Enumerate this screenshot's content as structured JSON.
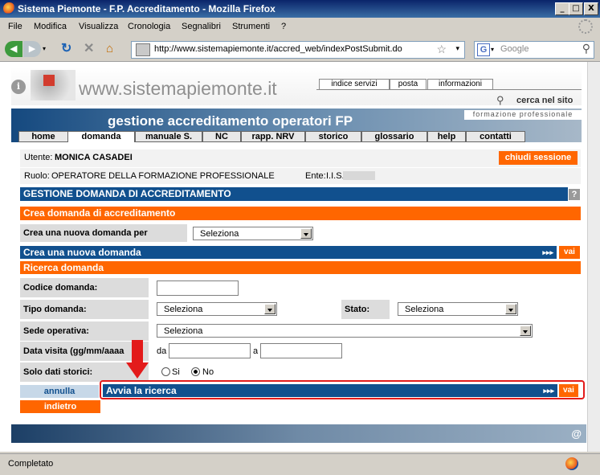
{
  "window": {
    "title": "Sistema Piemonte - F.P. Accreditamento - Mozilla Firefox",
    "minimize": "_",
    "maximize": "□",
    "close": "X"
  },
  "menu": [
    "File",
    "Modifica",
    "Visualizza",
    "Cronologia",
    "Segnalibri",
    "Strumenti",
    "?"
  ],
  "nav": {
    "url": "http://www.sistemapiemonte.it/accred_web/indexPostSubmit.do",
    "search_placeholder": "Google",
    "search_engine_icon": "G"
  },
  "site": {
    "logo_text": "www.sistemapiemonte.it",
    "top_tabs": [
      "indice servizi",
      "posta",
      "informazioni"
    ],
    "search_site": "cerca nel sito",
    "banner_title": "gestione accreditamento operatori FP",
    "banner_sub": "formazione professionale",
    "tabs": [
      "home",
      "domanda",
      "manuale S.",
      "NC",
      "rapp. NRV",
      "storico",
      "glossario",
      "help",
      "contatti"
    ],
    "active_tab": "domanda"
  },
  "user": {
    "utente_label": "Utente:",
    "utente_value": "MONICA CASADEI",
    "chiudi": "chiudi sessione",
    "ruolo_label": "Ruolo:",
    "ruolo_value": "OPERATORE DELLA FORMAZIONE PROFESSIONALE",
    "ente_label": "Ente:",
    "ente_value": "I.I.S."
  },
  "main": {
    "section_title": "GESTIONE DOMANDA DI ACCREDITAMENTO",
    "help_icon": "?",
    "crea_header": "Crea domanda di accreditamento",
    "crea_label": "Crea una nuova domanda per",
    "crea_select": "Seleziona",
    "crea_bar": "Crea una nuova domanda",
    "arrows": "▸▸▸",
    "vai": "vai",
    "ricerca_header": "Ricerca domanda",
    "codice_label": "Codice domanda:",
    "tipo_label": "Tipo domanda:",
    "tipo_select": "Seleziona",
    "stato_label": "Stato:",
    "stato_select": "Seleziona",
    "sede_label": "Sede operativa:",
    "sede_select": "Seleziona",
    "data_label": "Data visita (gg/mm/aaaa",
    "da": "da",
    "a": "a",
    "storici_label": "Solo dati storici:",
    "si": "Si",
    "no": "No",
    "annulla": "annulla",
    "avvia": "Avvia la ricerca",
    "indietro": "indietro"
  },
  "status": {
    "text": "Completato"
  },
  "colors": {
    "orange": "#ff6600",
    "blue": "#11508e",
    "red": "#e31b1b"
  }
}
